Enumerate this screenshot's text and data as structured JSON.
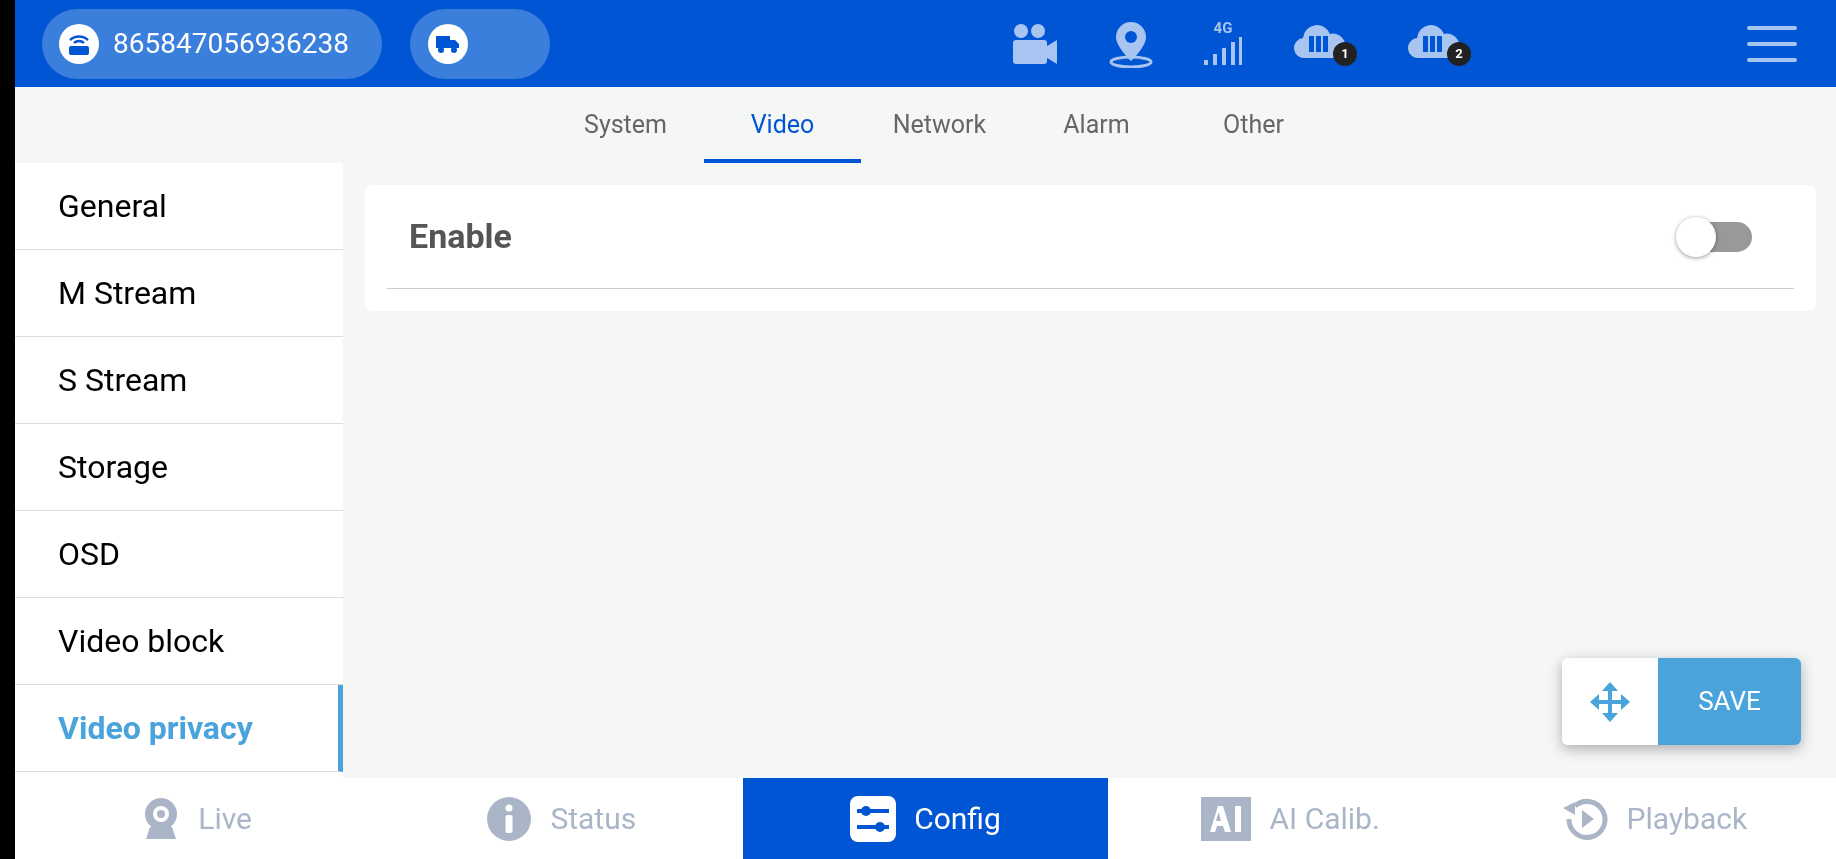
{
  "header": {
    "device_id": "865847056936238",
    "signal_label": "4G",
    "servers": [
      {
        "badge": "1"
      },
      {
        "badge": "2"
      }
    ]
  },
  "tabs": [
    {
      "label": "System",
      "selected": false
    },
    {
      "label": "Video",
      "selected": true
    },
    {
      "label": "Network",
      "selected": false
    },
    {
      "label": "Alarm",
      "selected": false
    },
    {
      "label": "Other",
      "selected": false
    }
  ],
  "sidebar": {
    "items": [
      {
        "label": "General",
        "selected": false
      },
      {
        "label": "M Stream",
        "selected": false
      },
      {
        "label": "S Stream",
        "selected": false
      },
      {
        "label": "Storage",
        "selected": false
      },
      {
        "label": "OSD",
        "selected": false
      },
      {
        "label": "Video block",
        "selected": false
      },
      {
        "label": "Video privacy",
        "selected": true
      }
    ]
  },
  "settings": [
    {
      "label": "Enable",
      "on": false
    }
  ],
  "save_button": "SAVE",
  "bottom_nav": [
    {
      "label": "Live",
      "selected": false
    },
    {
      "label": "Status",
      "selected": false
    },
    {
      "label": "Config",
      "selected": true
    },
    {
      "label": "AI Calib.",
      "selected": false
    },
    {
      "label": "Playback",
      "selected": false
    }
  ]
}
